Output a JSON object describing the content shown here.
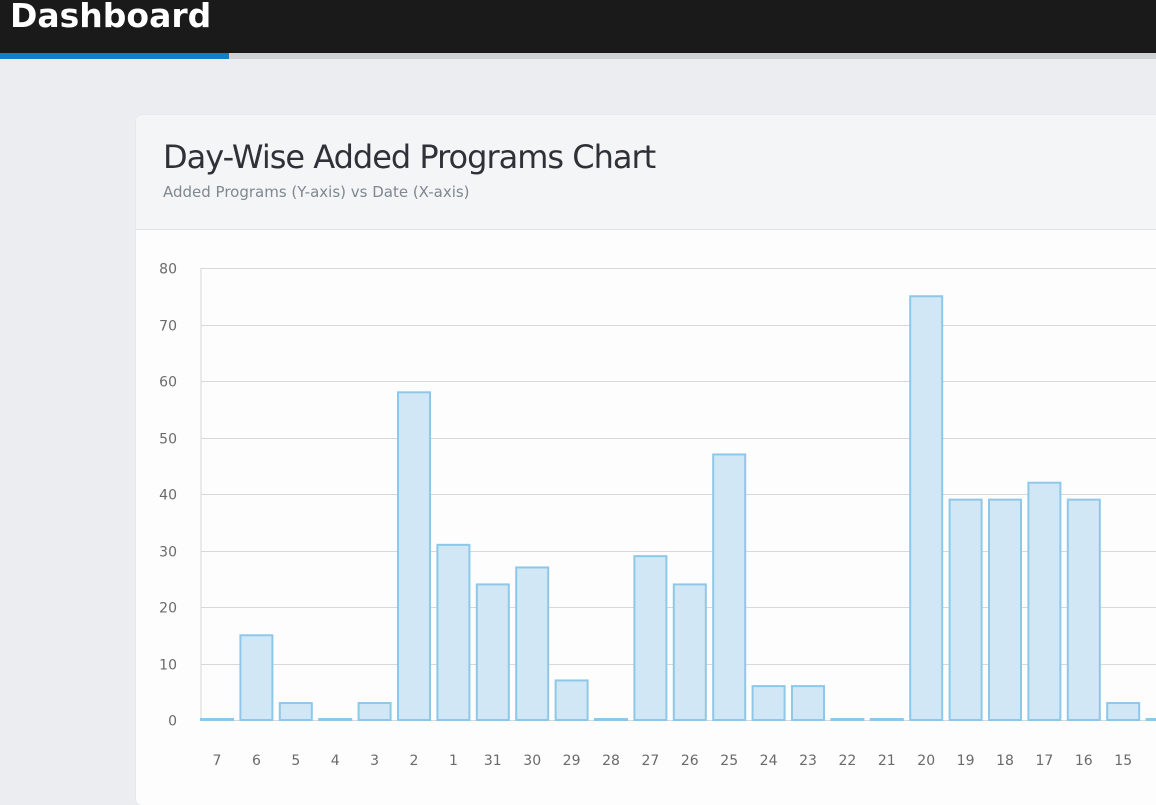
{
  "header": {
    "title": "Dashboard"
  },
  "progress": {
    "fraction": 0.198,
    "color": "#1180c9"
  },
  "card": {
    "title": "Day-Wise Added Programs Chart",
    "subtitle": "Added Programs (Y-axis) vs Date (X-axis)"
  },
  "chart_data": {
    "type": "bar",
    "title": "Day-Wise Added Programs Chart",
    "subtitle": "Added Programs (Y-axis) vs Date (X-axis)",
    "xlabel": "",
    "ylabel": "",
    "categories": [
      "7",
      "6",
      "5",
      "4",
      "3",
      "2",
      "1",
      "31",
      "30",
      "29",
      "28",
      "27",
      "26",
      "25",
      "24",
      "23",
      "22",
      "21",
      "20",
      "19",
      "18",
      "17",
      "16",
      "15"
    ],
    "values": [
      0,
      15,
      3,
      0,
      3,
      58,
      31,
      24,
      27,
      7,
      0,
      29,
      24,
      47,
      6,
      6,
      0,
      0,
      75,
      39,
      39,
      42,
      39,
      3
    ],
    "ylim": [
      0,
      80
    ],
    "yticks": [
      0,
      10,
      20,
      30,
      40,
      50,
      60,
      70,
      80
    ],
    "grid": true,
    "bar_fill": "#d2e7f5",
    "bar_stroke": "#8ec8e8"
  }
}
